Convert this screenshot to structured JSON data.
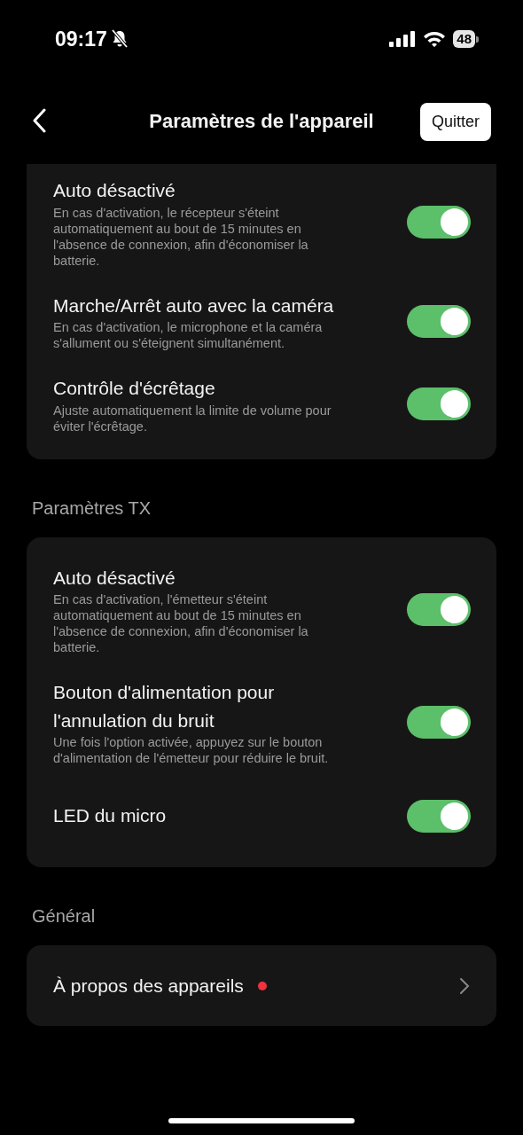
{
  "status_bar": {
    "time": "09:17",
    "silent": true,
    "battery": "48"
  },
  "header": {
    "title": "Paramètres de l'appareil",
    "button": "Quitter"
  },
  "sections": [
    {
      "settings": [
        {
          "title": "Auto désactivé",
          "description": "En cas d'activation, le récepteur s'éteint automatiquement au bout de 15 minutes en l'absence de connexion, afin d'économiser la batterie.",
          "on": true
        },
        {
          "title": "Marche/Arrêt auto avec la caméra",
          "description": "En cas d'activation, le microphone et la caméra s'allument ou s'éteignent simultanément.",
          "on": true
        },
        {
          "title": "Contrôle d'écrêtage",
          "description": "Ajuste automatiquement la limite de volume pour éviter l'écrêtage.",
          "on": true
        }
      ]
    },
    {
      "title": "Paramètres TX",
      "settings": [
        {
          "title": "Auto désactivé",
          "description": "En cas d'activation, l'émetteur s'éteint automatiquement au bout de 15 minutes en l'absence de connexion, afin d'économiser la batterie.",
          "on": true
        },
        {
          "title": "Bouton d'alimentation pour l'annulation du bruit",
          "description": "Une fois l'option activée, appuyez sur le bouton d'alimentation de l'émetteur pour réduire le bruit.",
          "on": true
        },
        {
          "title": "LED du micro",
          "on": true
        }
      ]
    },
    {
      "title": "Général",
      "links": [
        {
          "label": "À propos des appareils",
          "notification": true
        }
      ]
    }
  ]
}
